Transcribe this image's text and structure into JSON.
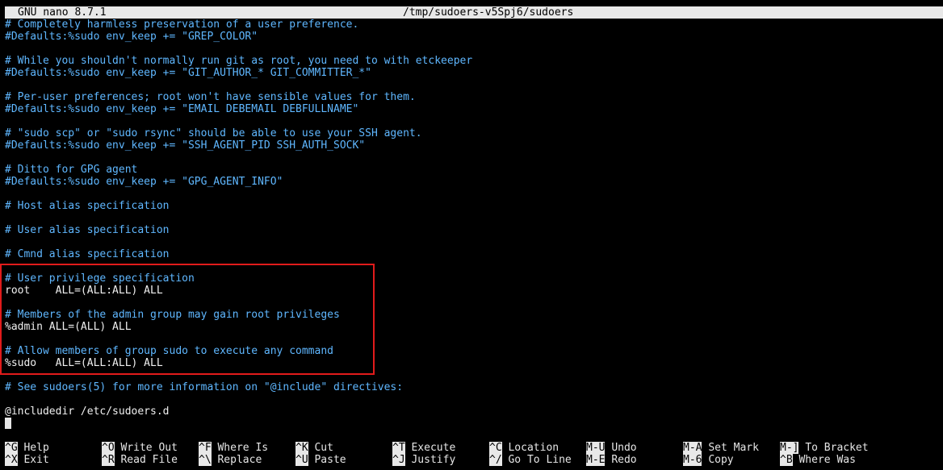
{
  "title_bar": {
    "app": "GNU nano 8.7.1",
    "file": "/tmp/sudoers-v5Spj6/sudoers"
  },
  "editor": {
    "lines": [
      {
        "text": "# Completely harmless preservation of a user preference.",
        "kind": "comment"
      },
      {
        "text": "#Defaults:%sudo env_keep += \"GREP_COLOR\"",
        "kind": "comment"
      },
      {
        "text": "",
        "kind": "plain"
      },
      {
        "text": "# While you shouldn't normally run git as root, you need to with etckeeper",
        "kind": "comment"
      },
      {
        "text": "#Defaults:%sudo env_keep += \"GIT_AUTHOR_* GIT_COMMITTER_*\"",
        "kind": "comment"
      },
      {
        "text": "",
        "kind": "plain"
      },
      {
        "text": "# Per-user preferences; root won't have sensible values for them.",
        "kind": "comment"
      },
      {
        "text": "#Defaults:%sudo env_keep += \"EMAIL DEBEMAIL DEBFULLNAME\"",
        "kind": "comment"
      },
      {
        "text": "",
        "kind": "plain"
      },
      {
        "text": "# \"sudo scp\" or \"sudo rsync\" should be able to use your SSH agent.",
        "kind": "comment"
      },
      {
        "text": "#Defaults:%sudo env_keep += \"SSH_AGENT_PID SSH_AUTH_SOCK\"",
        "kind": "comment"
      },
      {
        "text": "",
        "kind": "plain"
      },
      {
        "text": "# Ditto for GPG agent",
        "kind": "comment"
      },
      {
        "text": "#Defaults:%sudo env_keep += \"GPG_AGENT_INFO\"",
        "kind": "comment"
      },
      {
        "text": "",
        "kind": "plain"
      },
      {
        "text": "# Host alias specification",
        "kind": "comment"
      },
      {
        "text": "",
        "kind": "plain"
      },
      {
        "text": "# User alias specification",
        "kind": "comment"
      },
      {
        "text": "",
        "kind": "plain"
      },
      {
        "text": "# Cmnd alias specification",
        "kind": "comment"
      },
      {
        "text": "",
        "kind": "plain"
      },
      {
        "text": "# User privilege specification",
        "kind": "comment"
      },
      {
        "text": "root    ALL=(ALL:ALL) ALL",
        "kind": "plain"
      },
      {
        "text": "",
        "kind": "plain"
      },
      {
        "text": "# Members of the admin group may gain root privileges",
        "kind": "comment"
      },
      {
        "text": "%admin ALL=(ALL) ALL",
        "kind": "plain"
      },
      {
        "text": "",
        "kind": "plain"
      },
      {
        "text": "# Allow members of group sudo to execute any command",
        "kind": "comment"
      },
      {
        "text": "%sudo   ALL=(ALL:ALL) ALL",
        "kind": "plain"
      },
      {
        "text": "",
        "kind": "plain"
      },
      {
        "text": "# See sudoers(5) for more information on \"@include\" directives:",
        "kind": "comment"
      },
      {
        "text": "",
        "kind": "plain"
      },
      {
        "text": "@includedir /etc/sudoers.d",
        "kind": "plain"
      }
    ]
  },
  "shortcuts": [
    {
      "key": "^G",
      "label": "Help"
    },
    {
      "key": "^O",
      "label": "Write Out"
    },
    {
      "key": "^F",
      "label": "Where Is"
    },
    {
      "key": "^K",
      "label": "Cut"
    },
    {
      "key": "^T",
      "label": "Execute"
    },
    {
      "key": "^C",
      "label": "Location"
    },
    {
      "key": "M-U",
      "label": "Undo"
    },
    {
      "key": "M-A",
      "label": "Set Mark"
    },
    {
      "key": "M-]",
      "label": "To Bracket"
    },
    {
      "key": "^X",
      "label": "Exit"
    },
    {
      "key": "^R",
      "label": "Read File"
    },
    {
      "key": "^\\",
      "label": "Replace"
    },
    {
      "key": "^U",
      "label": "Paste"
    },
    {
      "key": "^J",
      "label": "Justify"
    },
    {
      "key": "^/",
      "label": "Go To Line"
    },
    {
      "key": "M-E",
      "label": "Redo"
    },
    {
      "key": "M-6",
      "label": "Copy"
    },
    {
      "key": "^B",
      "label": "Where Was"
    }
  ],
  "colors": {
    "background": "#000000",
    "comment": "#5fb7ff",
    "text": "#f0f0f0",
    "title_bar": "#e8e8e8",
    "highlight_border": "#e11b1b"
  }
}
